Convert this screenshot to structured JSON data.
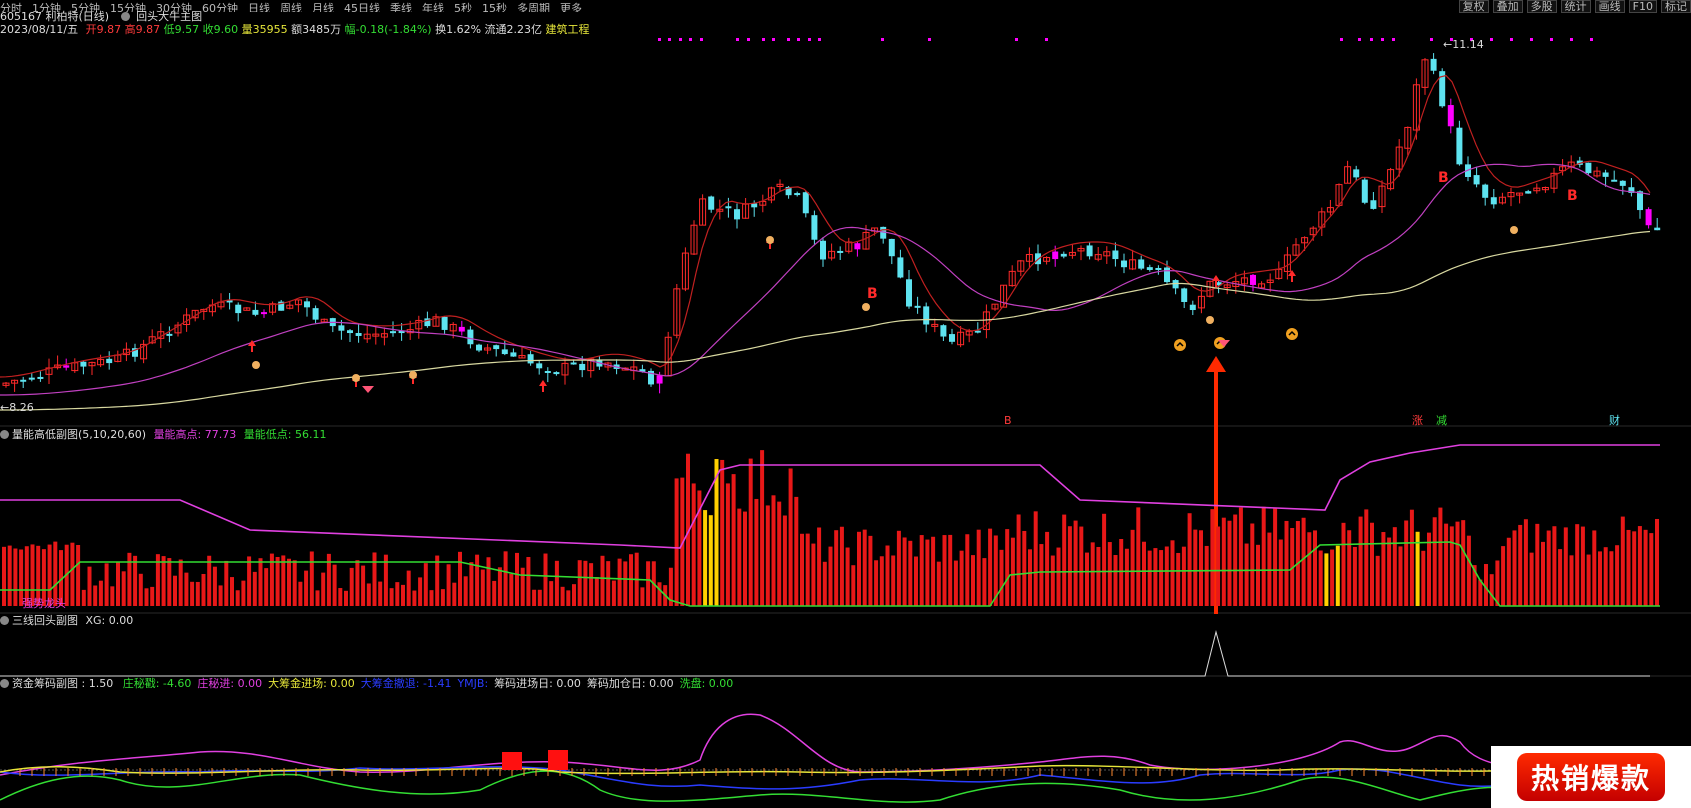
{
  "top_bar": {
    "periods": [
      "分时",
      "1分钟",
      "5分钟",
      "15分钟",
      "30分钟",
      "60分钟",
      "日线",
      "周线",
      "月线",
      "45日线",
      "季线",
      "年线",
      "5秒",
      "15秒",
      "多周期",
      "更多"
    ],
    "buttons": [
      "复权",
      "叠加",
      "多股",
      "统计",
      "画线",
      "F10",
      "标记"
    ]
  },
  "title_row": {
    "code_name": "605167 利柏特(日线)",
    "indicator": "回头大牛主图"
  },
  "quote_row": {
    "date": "2023/08/11/五",
    "open_label": "开",
    "open": "9.87",
    "high_label": "高",
    "high": "9.87",
    "low_label": "低",
    "low": "9.57",
    "close_label": "收",
    "close": "9.60",
    "vol_label": "量",
    "vol": "35955",
    "amt_label": "额",
    "amt": "3485万",
    "chg_label": "幅",
    "chg": "-0.18(-1.84%)",
    "turnover": "换1.62%",
    "float": "流通2.23亿",
    "sector": "建筑工程"
  },
  "main_chart": {
    "high_mark": "11.14",
    "low_mark": "8.26",
    "bottom_tags": [
      "B",
      "涨",
      "减",
      "财"
    ],
    "b_labels": [
      "B",
      "B",
      "B"
    ],
    "colors": {
      "up": "#ff2a2a",
      "down": "#5ee3f0",
      "ma1": "#c02020",
      "ma2": "#c040c0",
      "ma3": "#d8d8a0",
      "signal": "#ff00ff"
    }
  },
  "panel_volume": {
    "title": "量能高低副图(5,10,20,60)",
    "high_label": "量能高点: 77.73",
    "low_label": "量能低点: 56.11",
    "corner_text": "强势龙头"
  },
  "panel_xg": {
    "title": "三线回头副图",
    "value": "XG: 0.00"
  },
  "panel_funds": {
    "title": "资金筹码副图 : 1.50",
    "items": [
      {
        "label": "庄秘戳: -4.60",
        "color": "#33dd33"
      },
      {
        "label": "庄秘进: 0.00",
        "color": "#e040e0"
      },
      {
        "label": "大筹金进场: 0.00",
        "color": "#e6e63a"
      },
      {
        "label": "大筹金撤退: -1.41",
        "color": "#2a3cff"
      },
      {
        "label": "YMJB:",
        "color": "#2a3cff"
      },
      {
        "label": "筹码进场日: 0.00",
        "color": "#dddddd"
      },
      {
        "label": "筹码加仓日: 0.00",
        "color": "#dddddd"
      },
      {
        "label": "洗盘: 0.00",
        "color": "#33dd33"
      }
    ]
  },
  "badge": {
    "text": "热销爆款"
  }
}
